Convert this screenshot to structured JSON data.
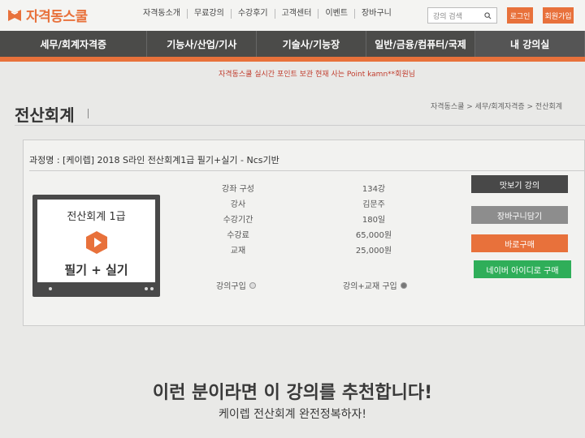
{
  "header": {
    "logo_text": "자격동스쿨",
    "nav": [
      "자격동소개",
      "무료강의",
      "수강후기",
      "고객센터",
      "이벤트",
      "장바구니"
    ],
    "search_placeholder": "강의 검색",
    "login_label": "로그인",
    "join_label": "회원가입"
  },
  "main_nav": [
    "세무/회계자격증",
    "기능사/산업/기사",
    "기술사/기능장",
    "일반/금융/컴퓨터/국제",
    "내 강의실"
  ],
  "notice": {
    "line1": "자격동스쿨 실시간 포인트 보관 현재 사는 Point kamn**회원님"
  },
  "page": {
    "title": "전산회계",
    "breadcrumb": "자격동스쿨 > 세무/회계자격증 > 전산회계"
  },
  "course": {
    "name": "과정명 : [케이렙] 2018 S라인 전산회계1급 필기+실기 - Ncs기반",
    "thumb_title": "전산회계 1급",
    "thumb_sub": "필기 + 실기",
    "info_labels": [
      "강좌 구성",
      "강사",
      "수강기간",
      "수강료",
      "교재"
    ],
    "info_values": [
      "134강",
      "김문주",
      "180일",
      "65,000원",
      "25,000원"
    ],
    "radio_lecture": "강의구입",
    "radio_lecture_book": "강의+교재 구입",
    "actions": {
      "preview": "맛보기 강의",
      "cart": "장바구니담기",
      "buy": "바로구매",
      "naver": "네이버 아이디로 구매"
    }
  },
  "recommend": {
    "title": "이런 분이라면 이 강의를 추천합니다!",
    "subtitle": "케이렙 전산회계 완전정복하자!"
  },
  "colors": {
    "accent": "#e8713b",
    "nav_bg": "#4b4b49",
    "naver_green": "#2fae59"
  }
}
